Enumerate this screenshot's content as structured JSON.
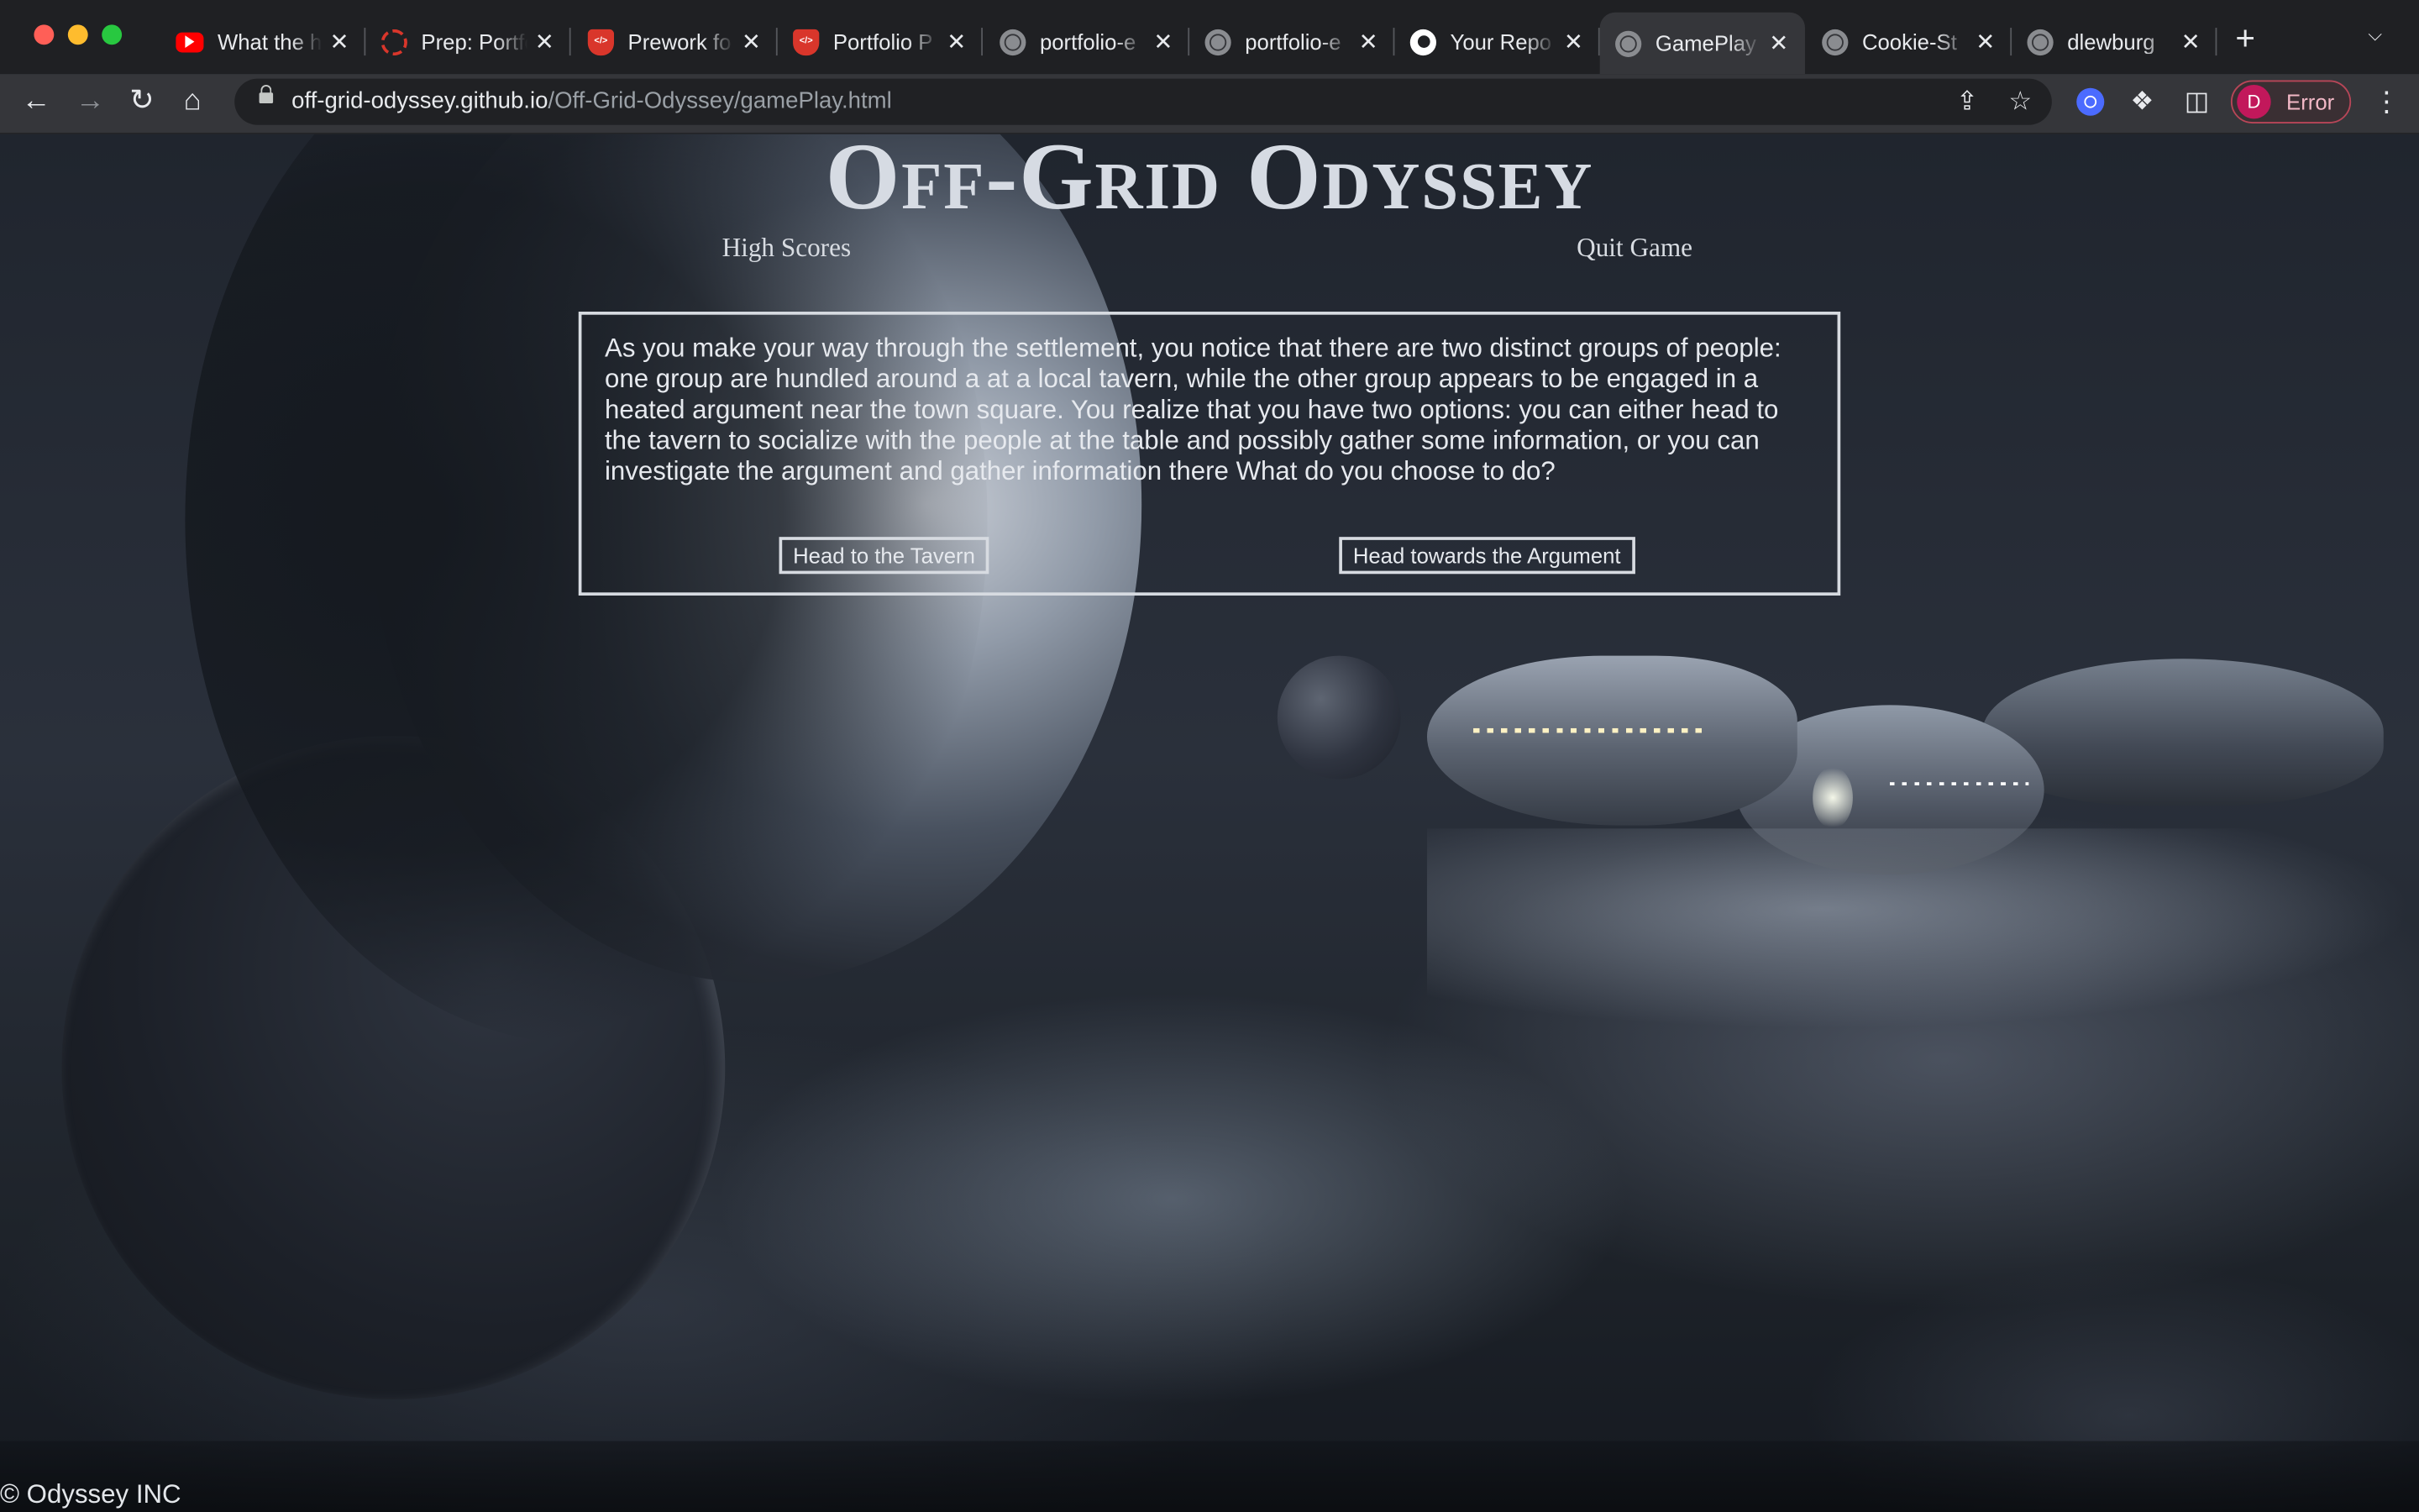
{
  "browser": {
    "tabs": [
      {
        "title": "What the h",
        "icon": "youtube-icon"
      },
      {
        "title": "Prep: Portfo",
        "icon": "codefellows-icon"
      },
      {
        "title": "Prework fo",
        "icon": "codefellows-shield-icon"
      },
      {
        "title": "Portfolio P",
        "icon": "codefellows-shield-icon"
      },
      {
        "title": "portfolio-e",
        "icon": "globe-icon"
      },
      {
        "title": "portfolio-e",
        "icon": "globe-icon"
      },
      {
        "title": "Your Repo",
        "icon": "github-icon"
      },
      {
        "title": "GamePlay",
        "icon": "globe-icon",
        "active": true
      },
      {
        "title": "Cookie-St",
        "icon": "globe-icon"
      },
      {
        "title": "dlewburg",
        "icon": "globe-icon"
      }
    ],
    "url_domain": "off-grid-odyssey.github.io",
    "url_path": "/Off-Grid-Odyssey/gamePlay.html",
    "profile_initial": "D",
    "profile_status": "Error",
    "accent_colors": {
      "profile": "#c2185b",
      "extension": "#4b6bff"
    }
  },
  "page": {
    "title": "Off-Grid Odyssey",
    "nav": {
      "high_scores": "High Scores",
      "quit_game": "Quit Game"
    },
    "story": "As you make your way through the settlement, you notice that there are two distinct groups of people: one group are hundled around a at a local tavern, while the other group appears to be engaged in a heated argument near the town square. You realize that you have two options: you can either head to the tavern to socialize with the people at the table and possibly gather some information, or you can investigate the argument and gather information there What do you choose to do?",
    "choices": {
      "tavern": "Head to the Tavern",
      "argument": "Head towards the Argument"
    },
    "footer": "© Odyssey INC"
  }
}
